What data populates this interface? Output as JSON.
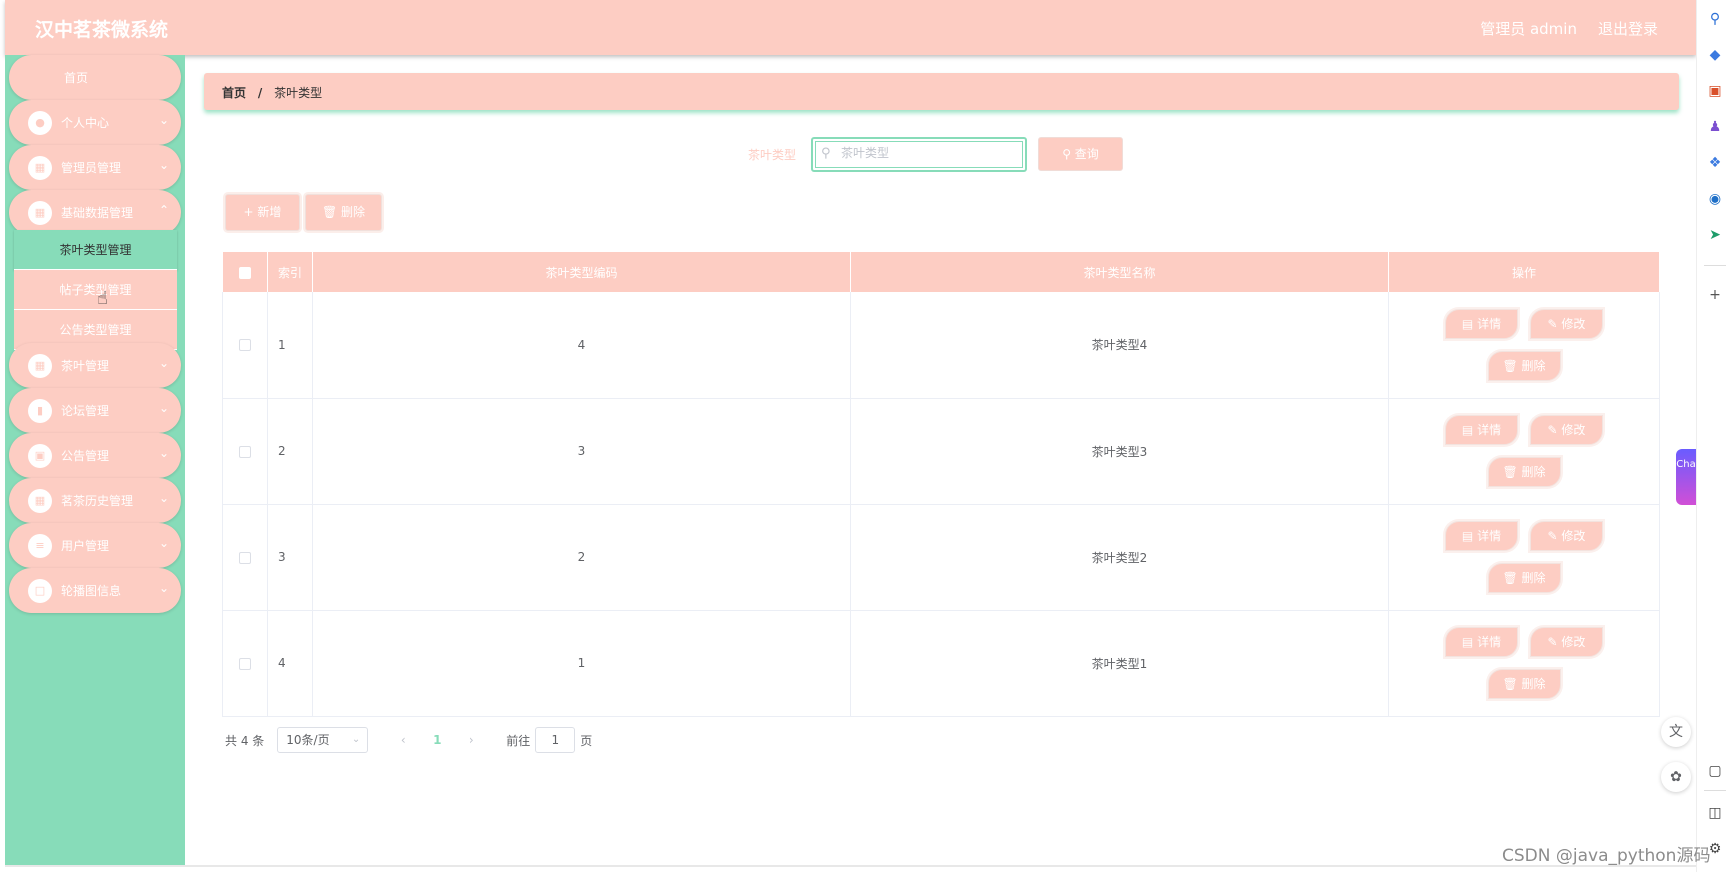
{
  "app": {
    "title": "汉中茗茶微系统"
  },
  "header": {
    "user_label": "管理员 admin",
    "logout_label": "退出登录"
  },
  "sidebar": {
    "home": "首页",
    "items": [
      {
        "label": "个人中心",
        "icon": "user-icon"
      },
      {
        "label": "管理员管理",
        "icon": "grid-icon"
      },
      {
        "label": "基础数据管理",
        "icon": "grid-icon"
      },
      {
        "label": "茶叶管理",
        "icon": "grid-icon"
      },
      {
        "label": "论坛管理",
        "icon": "bar-chart-icon"
      },
      {
        "label": "公告管理",
        "icon": "monitor-icon"
      },
      {
        "label": "茗茶历史管理",
        "icon": "grid-icon"
      },
      {
        "label": "用户管理",
        "icon": "list-icon"
      },
      {
        "label": "轮播图信息",
        "icon": "chat-icon"
      }
    ],
    "submenu": [
      "茶叶类型管理",
      "帖子类型管理",
      "公告类型管理"
    ],
    "active_submenu": "茶叶类型管理"
  },
  "breadcrumb": {
    "home": "首页",
    "sep": "/",
    "current": "茶叶类型"
  },
  "search": {
    "label": "茶叶类型",
    "placeholder": "茶叶类型",
    "value": "",
    "button": "查询"
  },
  "actions": {
    "add": "新增",
    "delete": "删除"
  },
  "table": {
    "headers": [
      "索引",
      "茶叶类型编码",
      "茶叶类型名称",
      "操作"
    ],
    "rows": [
      {
        "index": "1",
        "code": "4",
        "name": "茶叶类型4"
      },
      {
        "index": "2",
        "code": "3",
        "name": "茶叶类型3"
      },
      {
        "index": "3",
        "code": "2",
        "name": "茶叶类型2"
      },
      {
        "index": "4",
        "code": "1",
        "name": "茶叶类型1"
      }
    ],
    "ops": {
      "detail": "详情",
      "edit": "修改",
      "delete": "删除"
    }
  },
  "pager": {
    "total": "共 4 条",
    "size": "10条/页",
    "current": "1",
    "goto": "前往",
    "goto_value": "1",
    "page_unit": "页"
  },
  "watermark": "CSDN @java_python源码",
  "chat_tab": "Cha",
  "colors": {
    "primary": "#fdcdc3",
    "secondary": "#87dcb9"
  }
}
